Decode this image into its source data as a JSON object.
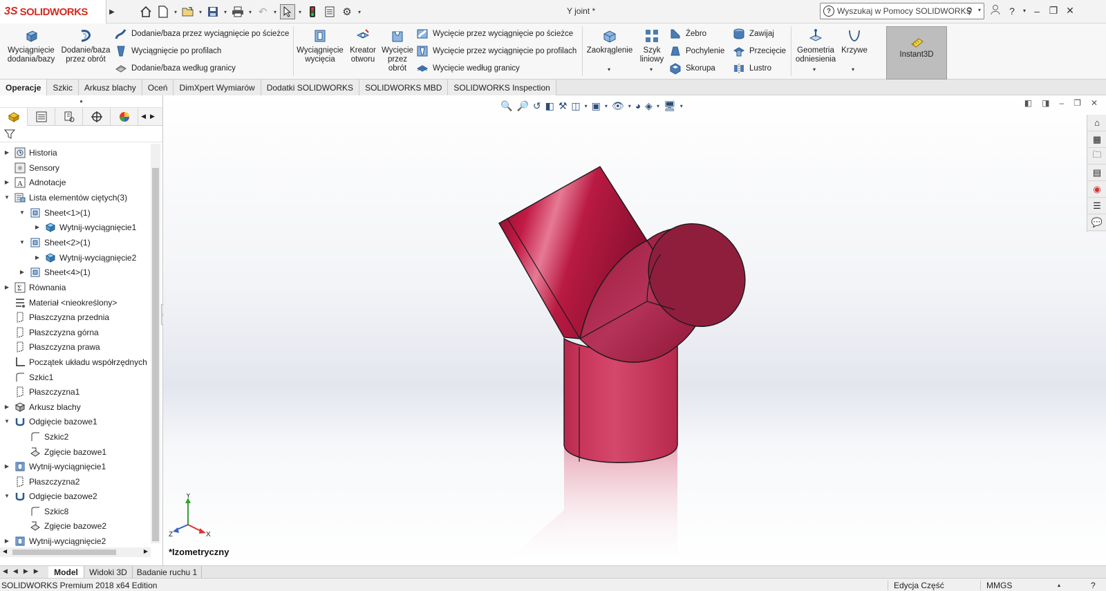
{
  "titlebar": {
    "logo_mark": "3S",
    "logo_text": "SOLIDWORKS",
    "document_title": "Y joint *",
    "search_placeholder": "Wyszukaj w Pomocy SOLIDWORKS"
  },
  "ribbon": {
    "extrude_boss": "Wyciągnięcie dodania/bazy",
    "revolve_boss": "Dodanie/baza przez obrót",
    "swept_boss": "Dodanie/baza przez wyciągnięcie po ścieżce",
    "lofted_boss": "Wyciągnięcie po profilach",
    "boundary_boss": "Dodanie/baza według granicy",
    "extrude_cut": "Wyciągnięcie wycięcia",
    "hole_wizard": "Kreator otworu",
    "revolve_cut": "Wycięcie przez obrót",
    "swept_cut": "Wycięcie przez wyciągnięcie po ścieżce",
    "lofted_cut": "Wycięcie przez wyciągnięcie po profilach",
    "boundary_cut": "Wycięcie według granicy",
    "fillet": "Zaokrąglenie",
    "linear_pattern": "Szyk liniowy",
    "rib": "Żebro",
    "draft": "Pochylenie",
    "shell": "Skorupa",
    "wrap": "Zawijaj",
    "intersect": "Przecięcie",
    "mirror": "Lustro",
    "reference_geometry": "Geometria odniesienia",
    "curves": "Krzywe",
    "instant3d": "Instant3D"
  },
  "tabs": [
    "Operacje",
    "Szkic",
    "Arkusz blachy",
    "Oceń",
    "DimXpert Wymiarów",
    "Dodatki SOLIDWORKS",
    "SOLIDWORKS MBD",
    "SOLIDWORKS Inspection"
  ],
  "tree": [
    {
      "label": "Historia",
      "expander": "▶",
      "icon": "history-icon"
    },
    {
      "label": "Sensory",
      "expander": "",
      "icon": "sensor-icon"
    },
    {
      "label": "Adnotacje",
      "expander": "▶",
      "icon": "annotation-icon"
    },
    {
      "label": "Lista elementów ciętych(3)",
      "expander": "▼",
      "icon": "cutlist-icon"
    },
    {
      "label": "Sheet<1>(1)",
      "expander": "▼",
      "icon": "cutlist-item-icon"
    },
    {
      "label": "Wytnij-wyciągnięcie1",
      "expander": "▶",
      "icon": "solid-body-icon"
    },
    {
      "label": "Sheet<2>(1)",
      "expander": "▼",
      "icon": "cutlist-item-icon"
    },
    {
      "label": "Wytnij-wyciągnięcie2",
      "expander": "▶",
      "icon": "solid-body-icon"
    },
    {
      "label": "Sheet<4>(1)",
      "expander": "▶",
      "icon": "cutlist-item-icon"
    },
    {
      "label": "Równania",
      "expander": "▶",
      "icon": "equations-icon"
    },
    {
      "label": "Materiał <nieokreślony>",
      "expander": "",
      "icon": "material-icon"
    },
    {
      "label": "Płaszczyzna przednia",
      "expander": "",
      "icon": "plane-icon"
    },
    {
      "label": "Płaszczyzna górna",
      "expander": "",
      "icon": "plane-icon"
    },
    {
      "label": "Płaszczyzna prawa",
      "expander": "",
      "icon": "plane-icon"
    },
    {
      "label": "Początek układu współrzędnych",
      "expander": "",
      "icon": "origin-icon"
    },
    {
      "label": "Szkic1",
      "expander": "",
      "icon": "sketch-icon"
    },
    {
      "label": "Płaszczyzna1",
      "expander": "",
      "icon": "plane-icon"
    },
    {
      "label": "Arkusz blachy",
      "expander": "▶",
      "icon": "sheet-metal-icon"
    },
    {
      "label": "Odgięcie bazowe1",
      "expander": "▼",
      "icon": "base-flange-icon"
    },
    {
      "label": "Szkic2",
      "expander": "",
      "icon": "sketch-icon"
    },
    {
      "label": "Zgięcie bazowe1",
      "expander": "",
      "icon": "flat-bend-icon"
    },
    {
      "label": "Wytnij-wyciągnięcie1",
      "expander": "▶",
      "icon": "cut-extrude-icon"
    },
    {
      "label": "Płaszczyzna2",
      "expander": "",
      "icon": "plane-icon"
    },
    {
      "label": "Odgięcie bazowe2",
      "expander": "▼",
      "icon": "base-flange-icon"
    },
    {
      "label": "Szkic8",
      "expander": "",
      "icon": "sketch-icon"
    },
    {
      "label": "Zgięcie bazowe2",
      "expander": "",
      "icon": "flat-bend-icon"
    },
    {
      "label": "Wytnij-wyciągnięcie2",
      "expander": "▶",
      "icon": "cut-extrude-icon"
    }
  ],
  "viewport": {
    "view_name": "*Izometryczny",
    "triad": {
      "x": "X",
      "y": "Y",
      "z": "Z"
    },
    "model_color": "#b81f44"
  },
  "bottom_tabs": [
    "Model",
    "Widoki 3D",
    "Badanie ruchu 1"
  ],
  "status": {
    "product": "SOLIDWORKS Premium 2018 x64 Edition",
    "mode": "Edycja Część",
    "units": "MMGS",
    "help": "?"
  }
}
